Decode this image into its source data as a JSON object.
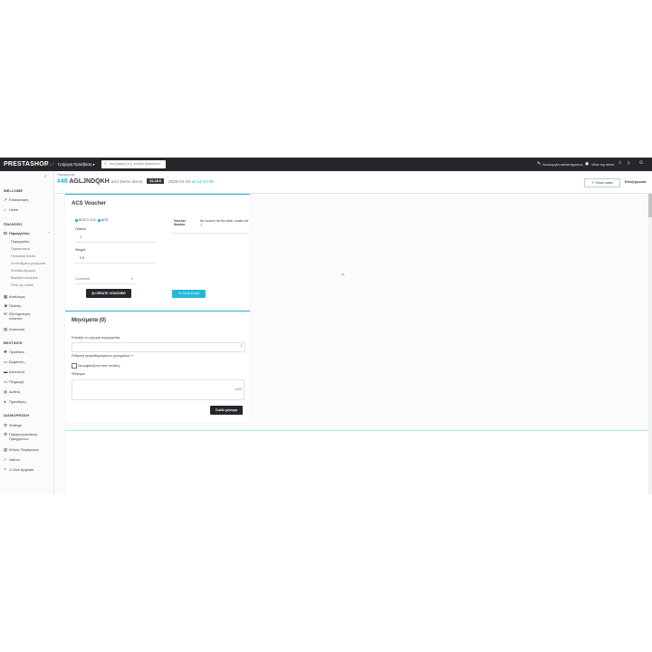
{
  "header": {
    "logo": "PRESTASHOP",
    "version": "8.1.7",
    "quick_access": "Γρήγορη Πρόσβαση",
    "search_placeholder": "Αναζήτηση (π.χ. κωδικό προϊόντος...",
    "store_label": "Λειτουργία καταστήματος",
    "view_store": "View my store"
  },
  "sidebar": {
    "sections": [
      {
        "label": "WELCOME"
      },
      {
        "label": "ΠΩΛΗΣΕΙΣ"
      },
      {
        "label": "ΒΕΛΤΙΩΣΗ"
      },
      {
        "label": "ΔΙΑΜΟΡΦΩΣΗ"
      }
    ],
    "items": [
      {
        "label": "Επισκόπηση",
        "icon": "trending-up-icon"
      },
      {
        "label": "Home",
        "icon": "home-icon"
      },
      {
        "label": "Παραγγελίες",
        "icon": "cart-icon"
      },
      {
        "label": "Κατάλογος",
        "icon": "store-icon"
      },
      {
        "label": "Πελάτες",
        "icon": "user-icon"
      },
      {
        "label": "Εξυπηρέτηση πελατών",
        "icon": "chat-icon"
      },
      {
        "label": "Στατιστικά",
        "icon": "chart-icon"
      },
      {
        "label": "Πρόσθετα",
        "icon": "puzzle-icon"
      },
      {
        "label": "Εμφάνιση",
        "icon": "monitor-icon"
      },
      {
        "label": "Αποστολή",
        "icon": "truck-icon"
      },
      {
        "label": "Πληρωμή",
        "icon": "card-icon"
      },
      {
        "label": "Διεθνές",
        "icon": "globe-icon"
      },
      {
        "label": "Προώθηση",
        "icon": "share-icon"
      },
      {
        "label": "Settings",
        "icon": "gear-icon"
      },
      {
        "label": "Παραμετροποίηση Προηγμένων",
        "icon": "settings-icon"
      },
      {
        "label": "Ειδικές Παράμετροι",
        "icon": "list-icon"
      },
      {
        "label": "Viamor",
        "icon": "check-icon"
      },
      {
        "label": "1-Click Upgrade",
        "icon": "upgrade-icon"
      }
    ],
    "subitems": [
      "Παραγγελίες",
      "Παραστατικά",
      "Πιστωτικά δελτία",
      "Συνδεδεμένα μηνύματα",
      "Καλάθια Αγορών",
      "BoxNow vouchers",
      "Print my orders"
    ]
  },
  "page": {
    "breadcrumb": "Παραγγελίες",
    "order_number": "#48",
    "reference": "AGLJNDQKH",
    "customer": "από Demo demo",
    "total": "€1.28 €",
    "date": "2025-01-24",
    "time": "at 14:24:58",
    "notes_button": "Show notes",
    "edit_link": "Επεξεργασία"
  },
  "voucher": {
    "title": "ACS Voucher",
    "option1": "ACS C.O.D.",
    "option2": "ACS",
    "packets_label": "Πακέτα",
    "packets_value": "1",
    "weight_label": "Weight",
    "weight_value": "0.5",
    "comment_placeholder": "Comment",
    "create_button": "CREATE VOUCHER",
    "voucher_col": "Voucher",
    "number_col": "Number",
    "no_voucher_text": "No voucher for this order, create one :)",
    "send_email": "Send Email"
  },
  "messages": {
    "title": "Μηνύματα (0)",
    "choose_label": "Επιλέξτε το μήνυμα παραγγελίας",
    "config_link": "Ρύθμιση προκαθορισμένων μηνυμάτων",
    "display_checkbox": "Να εμφανίζεται στον πελάτη;",
    "message_label": "*Μήνυμα",
    "char_count": "1200",
    "send_button": "Στείλε μήνυμα"
  }
}
